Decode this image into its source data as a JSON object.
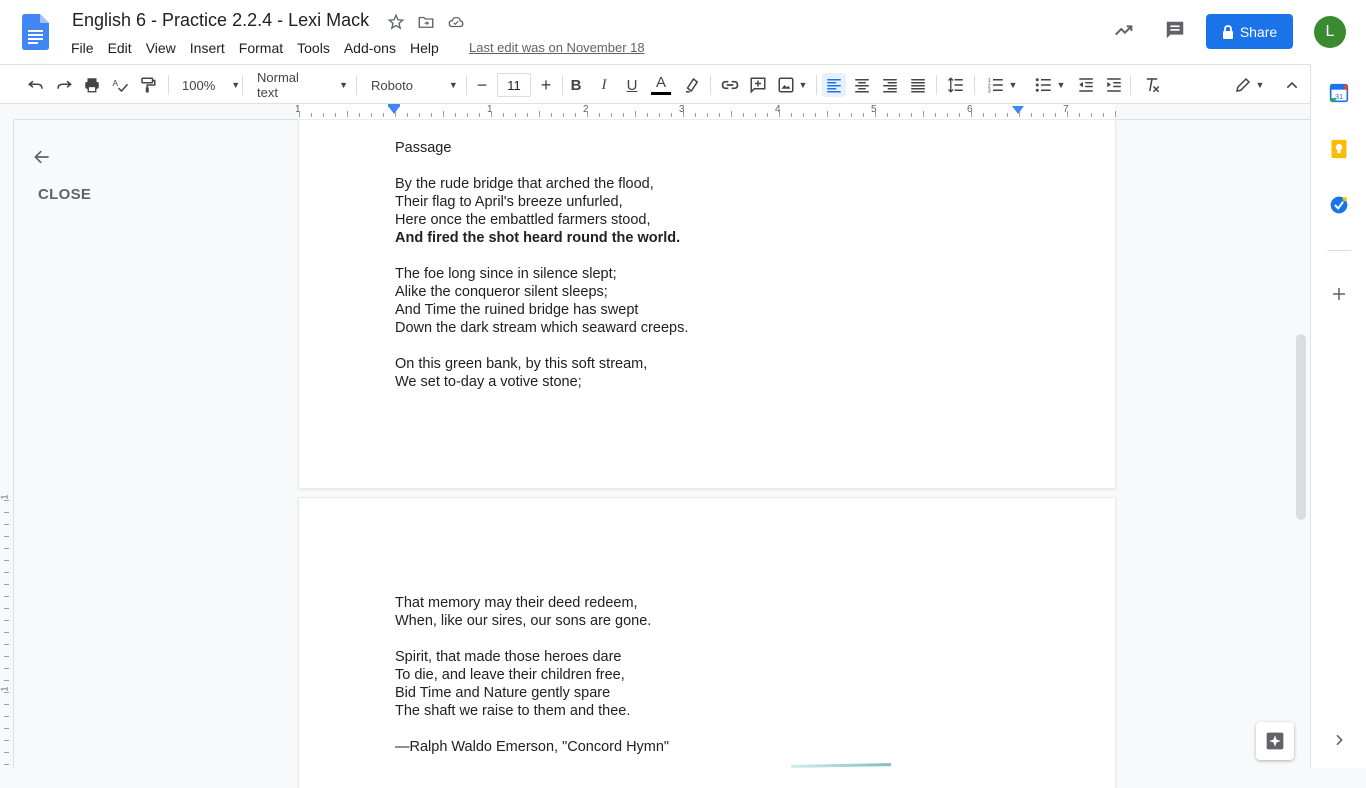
{
  "document": {
    "title": "English 6 - Practice 2.2.4 - Lexi Mack",
    "last_edit": "Last edit was on November 18"
  },
  "menu": [
    "File",
    "Edit",
    "View",
    "Insert",
    "Format",
    "Tools",
    "Add-ons",
    "Help"
  ],
  "header": {
    "share_label": "Share",
    "avatar_letter": "L",
    "share_color": "#1a73e8",
    "avatar_color": "#3a8a2f"
  },
  "toolbar": {
    "zoom": "100%",
    "style": "Normal text",
    "font": "Roboto",
    "font_size": "11",
    "text_color": "#000000"
  },
  "ruler": {
    "numbers": [
      "1",
      "1",
      "2",
      "3",
      "4",
      "5",
      "6",
      "7"
    ]
  },
  "vruler": {
    "numbers": [
      "1",
      "1"
    ]
  },
  "outline": {
    "close_label": "CLOSE"
  },
  "pages": {
    "page1_lines": [
      {
        "text": "Passage",
        "bold": false
      },
      {
        "text": "By the rude bridge that arched the flood,",
        "bold": false
      },
      {
        "text": "Their flag to April's breeze unfurled,",
        "bold": false
      },
      {
        "text": "Here once the embattled farmers stood,",
        "bold": false
      },
      {
        "text": "And fired the shot heard round the world.",
        "bold": true
      },
      {
        "text": "The foe long since in silence slept;",
        "bold": false
      },
      {
        "text": "Alike the conqueror silent sleeps;",
        "bold": false
      },
      {
        "text": "And Time the ruined bridge has swept",
        "bold": false
      },
      {
        "text": "Down the dark stream which seaward creeps.",
        "bold": false
      },
      {
        "text": "On this green bank, by this soft stream,",
        "bold": false
      },
      {
        "text": "We set to-day a votive stone;",
        "bold": false
      }
    ],
    "page2_lines": [
      {
        "text": "That memory may their deed redeem,",
        "bold": false
      },
      {
        "text": "When, like our sires, our sons are gone.",
        "bold": false
      },
      {
        "text": "Spirit, that made those heroes dare",
        "bold": false
      },
      {
        "text": "To die, and leave their children free,",
        "bold": false
      },
      {
        "text": "Bid Time and Nature gently spare",
        "bold": false
      },
      {
        "text": "The shaft we raise to them and thee.",
        "bold": false
      },
      {
        "text": "—Ralph Waldo Emerson, \"Concord Hymn\"",
        "bold": false
      }
    ]
  },
  "sidepanel": {
    "icons": [
      "calendar-icon",
      "keep-icon",
      "tasks-icon",
      "add-addon-icon"
    ],
    "calendar_day": "31"
  }
}
